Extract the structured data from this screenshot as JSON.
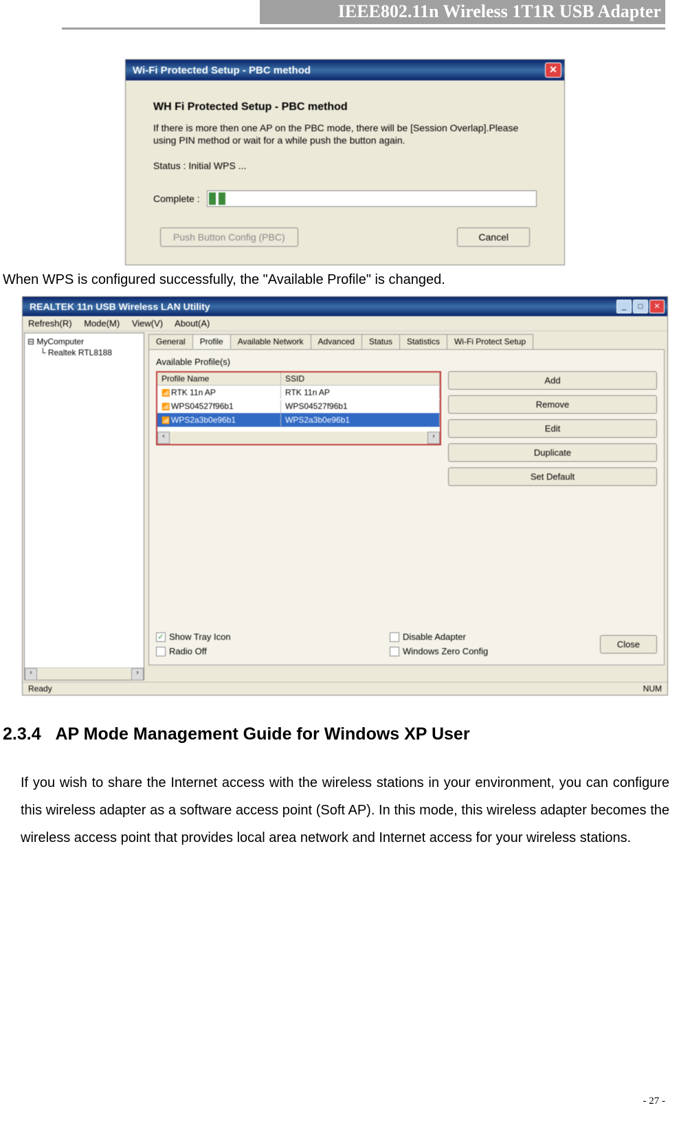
{
  "header": {
    "title": "IEEE802.11n Wireless 1T1R USB Adapter"
  },
  "wps_dialog": {
    "window_title": "Wi-Fi Protected Setup - PBC method",
    "heading": "WH Fi Protected Setup - PBC method",
    "description": "If there is more then one AP on the PBC mode, there will be [Session Overlap].Please using PIN method or wait for a while push the button again.",
    "status_label": "Status : Initial WPS ...",
    "progress_label": "Complete :",
    "pbc_button": "Push Button Config (PBC)",
    "cancel_button": "Cancel"
  },
  "caption": "When WPS is configured successfully, the \"Available Profile\" is changed.",
  "utility": {
    "window_title": "REALTEK 11n USB Wireless LAN Utility",
    "menus": [
      "Refresh(R)",
      "Mode(M)",
      "View(V)",
      "About(A)"
    ],
    "tree": {
      "root": "MyComputer",
      "child": "Realtek RTL8188"
    },
    "tabs": [
      "General",
      "Profile",
      "Available Network",
      "Advanced",
      "Status",
      "Statistics",
      "Wi-Fi Protect Setup"
    ],
    "active_tab": "Profile",
    "profile_section_label": "Available Profile(s)",
    "profile_columns": {
      "name": "Profile Name",
      "ssid": "SSID"
    },
    "profiles": [
      {
        "name": "RTK 11n AP",
        "ssid": "RTK 11n AP",
        "selected": false
      },
      {
        "name": "WPS04527f96b1",
        "ssid": "WPS04527f96b1",
        "selected": false
      },
      {
        "name": "WPS2a3b0e96b1",
        "ssid": "WPS2a3b0e96b1",
        "selected": true
      }
    ],
    "profile_buttons": [
      "Add",
      "Remove",
      "Edit",
      "Duplicate",
      "Set Default"
    ],
    "checkboxes": {
      "show_tray": {
        "label": "Show Tray Icon",
        "checked": true
      },
      "radio_off": {
        "label": "Radio Off",
        "checked": false
      },
      "disable_adapter": {
        "label": "Disable Adapter",
        "checked": false
      },
      "windows_zero": {
        "label": "Windows Zero Config",
        "checked": false
      }
    },
    "close_button": "Close",
    "status_left": "Ready",
    "status_right": "NUM"
  },
  "section": {
    "heading_num": "2.3.4",
    "heading_text": "AP Mode Management Guide for Windows XP User",
    "body": "If you wish to share the Internet access with the wireless stations in your environment, you can configure this wireless adapter as a software access point (Soft AP). In this mode, this wireless adapter becomes the wireless access point that provides local area network and Internet access for your wireless stations."
  },
  "page_number": "- 27 -"
}
